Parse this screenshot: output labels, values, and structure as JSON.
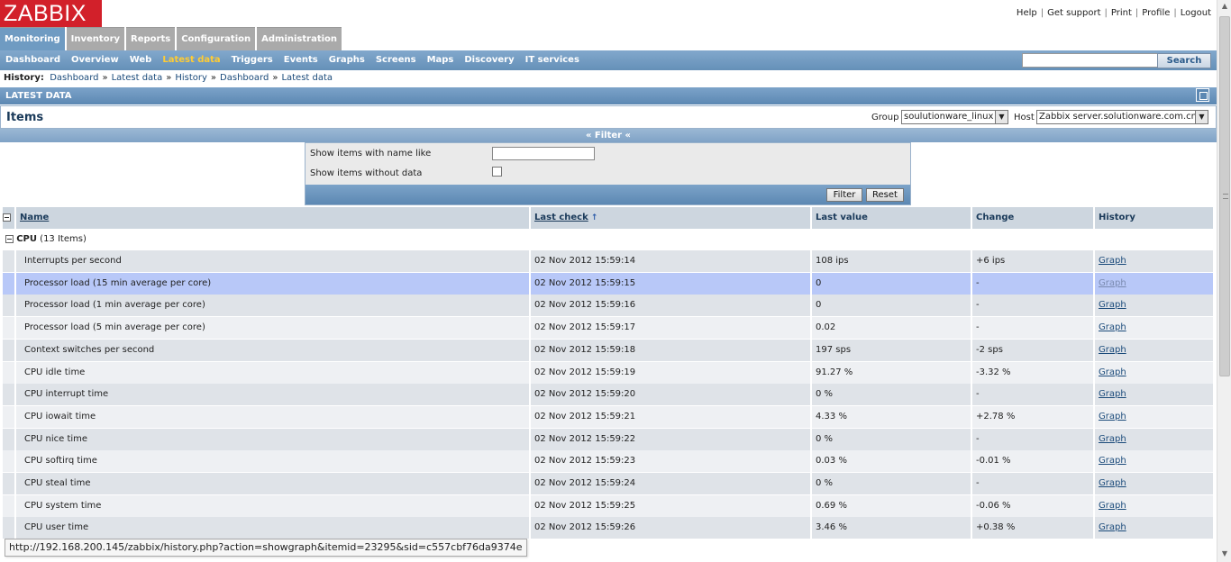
{
  "logo": "ZABBIX",
  "top_links": [
    "Help",
    "Get support",
    "Print",
    "Profile",
    "Logout"
  ],
  "main_tabs": [
    {
      "label": "Monitoring",
      "active": true
    },
    {
      "label": "Inventory",
      "active": false
    },
    {
      "label": "Reports",
      "active": false
    },
    {
      "label": "Configuration",
      "active": false
    },
    {
      "label": "Administration",
      "active": false
    }
  ],
  "sub_menu": [
    {
      "label": "Dashboard",
      "active": false
    },
    {
      "label": "Overview",
      "active": false
    },
    {
      "label": "Web",
      "active": false
    },
    {
      "label": "Latest data",
      "active": true
    },
    {
      "label": "Triggers",
      "active": false
    },
    {
      "label": "Events",
      "active": false
    },
    {
      "label": "Graphs",
      "active": false
    },
    {
      "label": "Screens",
      "active": false
    },
    {
      "label": "Maps",
      "active": false
    },
    {
      "label": "Discovery",
      "active": false
    },
    {
      "label": "IT services",
      "active": false
    }
  ],
  "search": {
    "value": "",
    "button": "Search"
  },
  "history": {
    "label": "History:",
    "items": [
      "Dashboard",
      "Latest data",
      "History",
      "Dashboard",
      "Latest data"
    ],
    "separator": "»"
  },
  "section_title": "LATEST DATA",
  "items_header": {
    "title": "Items",
    "group_label": "Group",
    "group_value": "soulutionware_linux",
    "host_label": "Host",
    "host_value": "Zabbix server.solutionware.com.cn"
  },
  "filter": {
    "toggle_label": "« Filter «",
    "name_like_label": "Show items with name like",
    "name_like_value": "",
    "without_data_label": "Show items without data",
    "without_data_checked": false,
    "filter_button": "Filter",
    "reset_button": "Reset"
  },
  "table": {
    "columns": [
      "Name",
      "Last check",
      "Last value",
      "Change",
      "History"
    ],
    "group": {
      "name": "CPU",
      "count": "(13 Items)"
    },
    "rows": [
      {
        "name": "Interrupts per second",
        "last_check": "02 Nov 2012 15:59:14",
        "last_value": "108 ips",
        "change": "+6 ips",
        "history": "Graph"
      },
      {
        "name": "Processor load (15 min average per core)",
        "last_check": "02 Nov 2012 15:59:15",
        "last_value": "0",
        "change": "-",
        "history": "Graph",
        "highlighted": true
      },
      {
        "name": "Processor load (1 min average per core)",
        "last_check": "02 Nov 2012 15:59:16",
        "last_value": "0",
        "change": "-",
        "history": "Graph"
      },
      {
        "name": "Processor load (5 min average per core)",
        "last_check": "02 Nov 2012 15:59:17",
        "last_value": "0.02",
        "change": "-",
        "history": "Graph"
      },
      {
        "name": "Context switches per second",
        "last_check": "02 Nov 2012 15:59:18",
        "last_value": "197 sps",
        "change": "-2 sps",
        "history": "Graph"
      },
      {
        "name": "CPU idle time",
        "last_check": "02 Nov 2012 15:59:19",
        "last_value": "91.27 %",
        "change": "-3.32 %",
        "history": "Graph"
      },
      {
        "name": "CPU interrupt time",
        "last_check": "02 Nov 2012 15:59:20",
        "last_value": "0 %",
        "change": "-",
        "history": "Graph"
      },
      {
        "name": "CPU iowait time",
        "last_check": "02 Nov 2012 15:59:21",
        "last_value": "4.33 %",
        "change": "+2.78 %",
        "history": "Graph"
      },
      {
        "name": "CPU nice time",
        "last_check": "02 Nov 2012 15:59:22",
        "last_value": "0 %",
        "change": "-",
        "history": "Graph"
      },
      {
        "name": "CPU softirq time",
        "last_check": "02 Nov 2012 15:59:23",
        "last_value": "0.03 %",
        "change": "-0.01 %",
        "history": "Graph"
      },
      {
        "name": "CPU steal time",
        "last_check": "02 Nov 2012 15:59:24",
        "last_value": "0 %",
        "change": "-",
        "history": "Graph"
      },
      {
        "name": "CPU system time",
        "last_check": "02 Nov 2012 15:59:25",
        "last_value": "0.69 %",
        "change": "-0.06 %",
        "history": "Graph"
      },
      {
        "name": "CPU user time",
        "last_check": "02 Nov 2012 15:59:26",
        "last_value": "3.46 %",
        "change": "+0.38 %",
        "history": "Graph"
      }
    ]
  },
  "status_url": "http://192.168.200.145/zabbix/history.php?action=showgraph&itemid=23295&sid=c557cbf76da9374e"
}
